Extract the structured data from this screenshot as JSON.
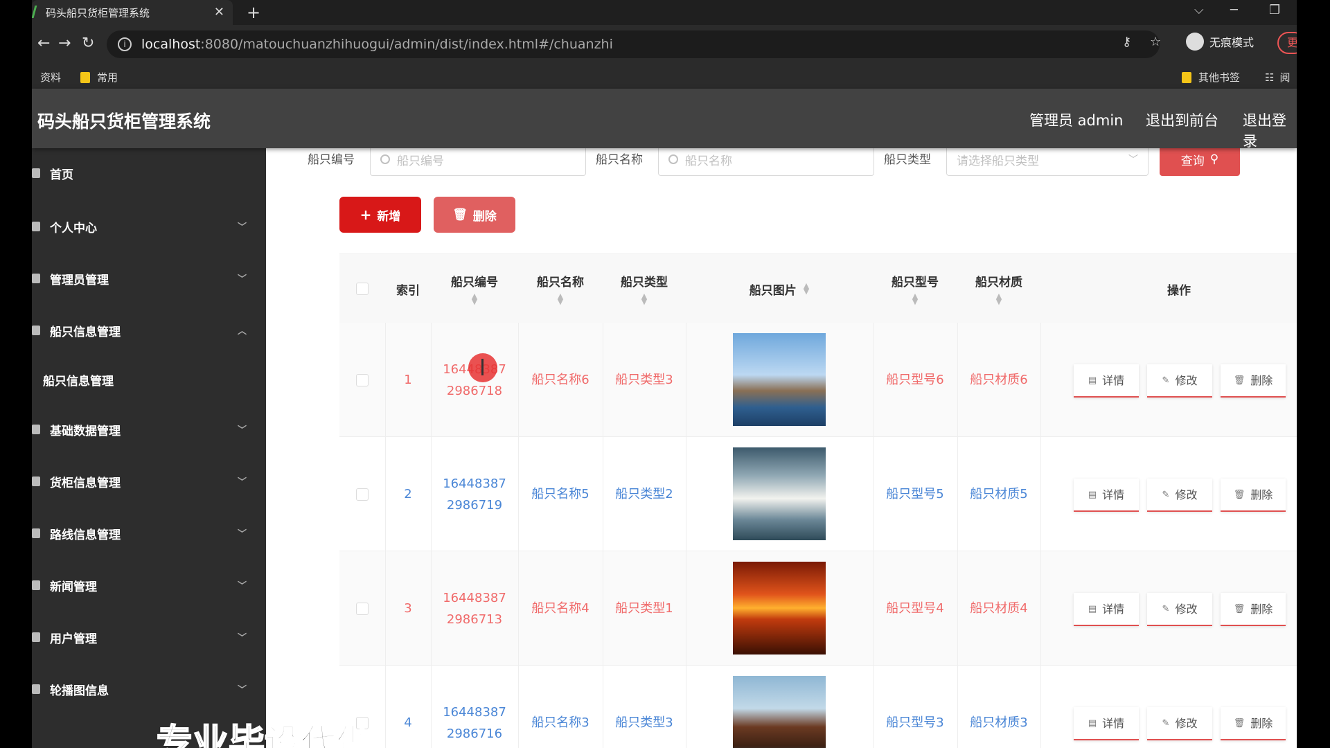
{
  "browser": {
    "tab_title": "码头船只货柜管理系统",
    "tab_close": "✕",
    "new_tab": "+",
    "url_host": "localhost",
    "url_rest": ":8080/matouchuanzhihuogui/admin/dist/index.html#/chuanzhi",
    "incognito_label": "无痕模式",
    "update_label": "更",
    "bookmarks": [
      "资料",
      "常用"
    ],
    "other_bookmarks": "其他书签",
    "reader_label": "阅"
  },
  "header": {
    "app_title": "码头船只货柜管理系统",
    "admin_label": "管理员 admin",
    "to_front": "退出到前台",
    "logout": "退出登录"
  },
  "sidebar": {
    "items": [
      {
        "label": "首页",
        "icon": "home-icon"
      },
      {
        "label": "个人中心",
        "icon": "user-icon"
      },
      {
        "label": "管理员管理",
        "icon": "list-icon"
      },
      {
        "label": "船只信息管理",
        "icon": "ship-icon"
      },
      {
        "label": "基础数据管理",
        "icon": "grid-icon"
      },
      {
        "label": "货柜信息管理",
        "icon": "container-icon"
      },
      {
        "label": "路线信息管理",
        "icon": "route-icon"
      },
      {
        "label": "新闻管理",
        "icon": "news-icon"
      },
      {
        "label": "用户管理",
        "icon": "users-icon"
      },
      {
        "label": "轮播图信息",
        "icon": "carousel-icon"
      }
    ],
    "sub_item": "船只信息管理"
  },
  "search": {
    "ship_no_label": "船只编号",
    "ship_no_placeholder": "船只编号",
    "ship_name_label": "船只名称",
    "ship_name_placeholder": "船只名称",
    "ship_type_label": "船只类型",
    "ship_type_placeholder": "请选择船只类型",
    "query_label": "查询"
  },
  "actions": {
    "add_label": "新增",
    "delete_label": "删除"
  },
  "table": {
    "headers": {
      "index": "索引",
      "ship_no": "船只编号",
      "ship_name": "船只名称",
      "ship_type": "船只类型",
      "ship_image": "船只图片",
      "ship_model": "船只型号",
      "ship_material": "船只材质",
      "operation": "操作"
    },
    "op_labels": {
      "detail": "详情",
      "edit": "修改",
      "delete": "删除"
    },
    "rows": [
      {
        "index": "1",
        "no_a": "16448387",
        "no_b": "2986718",
        "name": "船只名称6",
        "type": "船只类型3",
        "model": "船只型号6",
        "material": "船只材质6",
        "color": "#f06a6a"
      },
      {
        "index": "2",
        "no_a": "16448387",
        "no_b": "2986719",
        "name": "船只名称5",
        "type": "船只类型2",
        "model": "船只型号5",
        "material": "船只材质5",
        "color": "#4a86d6"
      },
      {
        "index": "3",
        "no_a": "16448387",
        "no_b": "2986713",
        "name": "船只名称4",
        "type": "船只类型1",
        "model": "船只型号4",
        "material": "船只材质4",
        "color": "#f06a6a"
      },
      {
        "index": "4",
        "no_a": "16448387",
        "no_b": "2986716",
        "name": "船只名称3",
        "type": "船只类型3",
        "model": "船只型号3",
        "material": "船只材质3",
        "color": "#4a86d6"
      }
    ]
  },
  "overlay_text": "专业毕设代做"
}
